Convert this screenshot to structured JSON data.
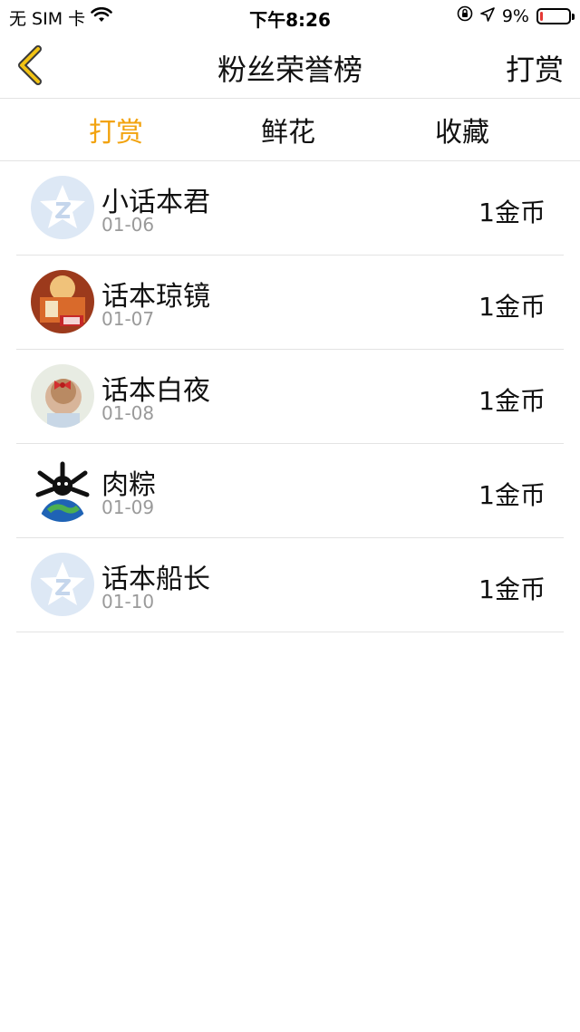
{
  "status_bar": {
    "carrier": "无 SIM 卡",
    "time": "下午8:26",
    "battery": "9%",
    "battery_level": 0.09
  },
  "nav": {
    "title": "粉丝荣誉榜",
    "right_label": "打赏",
    "back_icon": "chevron-left-icon"
  },
  "tabs": [
    {
      "label": "打赏",
      "active": true
    },
    {
      "label": "鲜花",
      "active": false
    },
    {
      "label": "收藏",
      "active": false
    }
  ],
  "colors": {
    "accent": "#f2a30f",
    "divider": "#e3e3e3",
    "date_text": "#9a9a9a"
  },
  "fans": [
    {
      "name": "小话本君",
      "date": "01-06",
      "amount": "1金币",
      "avatar": "default-qq-avatar"
    },
    {
      "name": "话本琼镜",
      "date": "01-07",
      "amount": "1金币",
      "avatar": "anime-avatar"
    },
    {
      "name": "话本白夜",
      "date": "01-08",
      "amount": "1金币",
      "avatar": "girl-bow-avatar"
    },
    {
      "name": "肉粽",
      "date": "01-09",
      "amount": "1金币",
      "avatar": "earth-character-avatar"
    },
    {
      "name": "话本船长",
      "date": "01-10",
      "amount": "1金币",
      "avatar": "default-qq-avatar"
    }
  ]
}
